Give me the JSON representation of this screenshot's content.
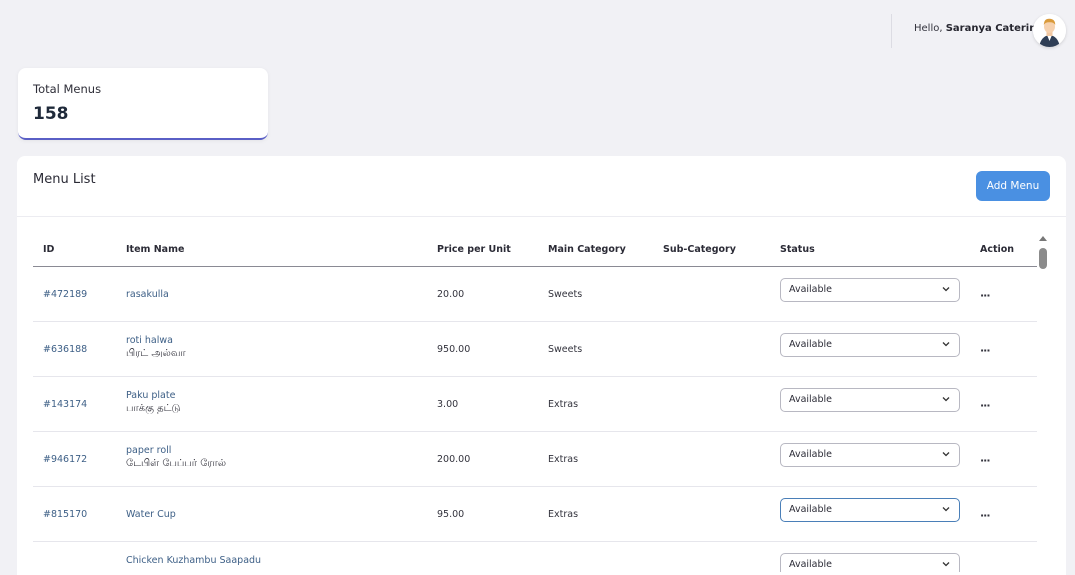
{
  "header": {
    "greeting_prefix": "Hello, ",
    "user_name": "Saranya Catering"
  },
  "stats": {
    "label": "Total Menus",
    "value": "158"
  },
  "menu_list": {
    "title": "Menu List",
    "add_button": "Add Menu",
    "columns": [
      "ID",
      "Item Name",
      "Price per Unit",
      "Main Category",
      "Sub-Category",
      "Status",
      "Action"
    ],
    "rows": [
      {
        "id": "#472189",
        "name": "rasakulla",
        "tamil": "",
        "price": "20.00",
        "main": "Sweets",
        "sub": "",
        "status": "Available"
      },
      {
        "id": "#636188",
        "name": "roti halwa",
        "tamil": "பிரட் அல்வா",
        "price": "950.00",
        "main": "Sweets",
        "sub": "",
        "status": "Available"
      },
      {
        "id": "#143174",
        "name": "Paku plate",
        "tamil": "பாக்கு தட்டு",
        "price": "3.00",
        "main": "Extras",
        "sub": "",
        "status": "Available"
      },
      {
        "id": "#946172",
        "name": "paper roll",
        "tamil": "டேபிள் பேப்பர் ரோல்",
        "price": "200.00",
        "main": "Extras",
        "sub": "",
        "status": "Available"
      },
      {
        "id": "#815170",
        "name": "Water Cup",
        "tamil": "",
        "price": "95.00",
        "main": "Extras",
        "sub": "",
        "status": "Available"
      },
      {
        "id": "",
        "name": "Chicken Kuzhambu Saapadu",
        "tamil": "",
        "price": "",
        "main": "",
        "sub": "",
        "status": "Available"
      }
    ]
  },
  "colors": {
    "accent": "#4a90e2",
    "card_border": "#5a5fc6",
    "link": "#3d5f86"
  },
  "icons": {
    "avatar": "user-avatar",
    "status_dropdown": "chevron-down-icon",
    "action": "more-horizontal-icon"
  }
}
